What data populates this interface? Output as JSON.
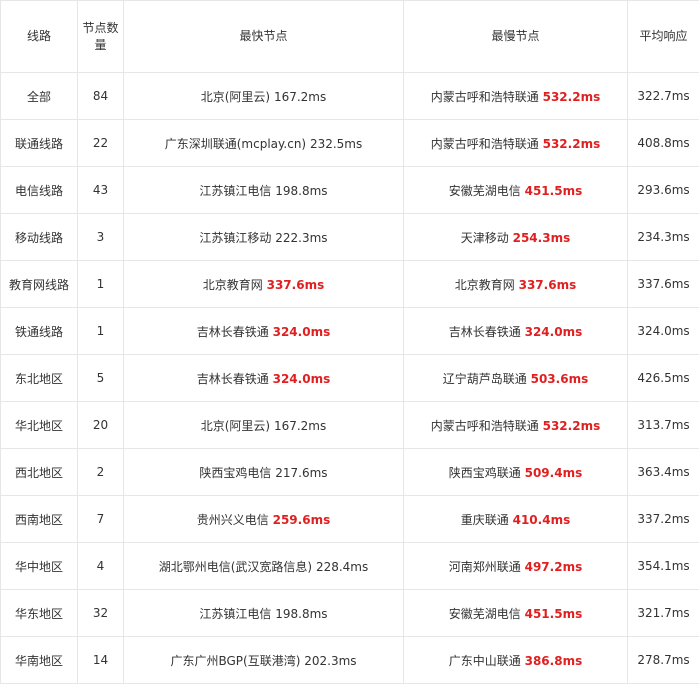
{
  "headers": {
    "line": "线路",
    "count": "节点数量",
    "fastest": "最快节点",
    "slowest": "最慢节点",
    "avg": "平均响应"
  },
  "highlight_color": "#e02020",
  "rows": [
    {
      "line": "全部",
      "count": "84",
      "fast_name": "北京(阿里云)",
      "fast_ms": "167.2ms",
      "fast_hl": false,
      "slow_name": "内蒙古呼和浩特联通",
      "slow_ms": "532.2ms",
      "slow_hl": true,
      "avg": "322.7ms"
    },
    {
      "line": "联通线路",
      "count": "22",
      "fast_name": "广东深圳联通(mcplay.cn)",
      "fast_ms": "232.5ms",
      "fast_hl": false,
      "slow_name": "内蒙古呼和浩特联通",
      "slow_ms": "532.2ms",
      "slow_hl": true,
      "avg": "408.8ms"
    },
    {
      "line": "电信线路",
      "count": "43",
      "fast_name": "江苏镇江电信",
      "fast_ms": "198.8ms",
      "fast_hl": false,
      "slow_name": "安徽芜湖电信",
      "slow_ms": "451.5ms",
      "slow_hl": true,
      "avg": "293.6ms"
    },
    {
      "line": "移动线路",
      "count": "3",
      "fast_name": "江苏镇江移动",
      "fast_ms": "222.3ms",
      "fast_hl": false,
      "slow_name": "天津移动",
      "slow_ms": "254.3ms",
      "slow_hl": true,
      "avg": "234.3ms"
    },
    {
      "line": "教育网线路",
      "count": "1",
      "fast_name": "北京教育网",
      "fast_ms": "337.6ms",
      "fast_hl": true,
      "slow_name": "北京教育网",
      "slow_ms": "337.6ms",
      "slow_hl": true,
      "avg": "337.6ms"
    },
    {
      "line": "铁通线路",
      "count": "1",
      "fast_name": "吉林长春铁通",
      "fast_ms": "324.0ms",
      "fast_hl": true,
      "slow_name": "吉林长春铁通",
      "slow_ms": "324.0ms",
      "slow_hl": true,
      "avg": "324.0ms"
    },
    {
      "line": "东北地区",
      "count": "5",
      "fast_name": "吉林长春铁通",
      "fast_ms": "324.0ms",
      "fast_hl": true,
      "slow_name": "辽宁葫芦岛联通",
      "slow_ms": "503.6ms",
      "slow_hl": true,
      "avg": "426.5ms"
    },
    {
      "line": "华北地区",
      "count": "20",
      "fast_name": "北京(阿里云)",
      "fast_ms": "167.2ms",
      "fast_hl": false,
      "slow_name": "内蒙古呼和浩特联通",
      "slow_ms": "532.2ms",
      "slow_hl": true,
      "avg": "313.7ms"
    },
    {
      "line": "西北地区",
      "count": "2",
      "fast_name": "陕西宝鸡电信",
      "fast_ms": "217.6ms",
      "fast_hl": false,
      "slow_name": "陕西宝鸡联通",
      "slow_ms": "509.4ms",
      "slow_hl": true,
      "avg": "363.4ms"
    },
    {
      "line": "西南地区",
      "count": "7",
      "fast_name": "贵州兴义电信",
      "fast_ms": "259.6ms",
      "fast_hl": true,
      "slow_name": "重庆联通",
      "slow_ms": "410.4ms",
      "slow_hl": true,
      "avg": "337.2ms"
    },
    {
      "line": "华中地区",
      "count": "4",
      "fast_name": "湖北鄂州电信(武汉宽路信息)",
      "fast_ms": "228.4ms",
      "fast_hl": false,
      "slow_name": "河南郑州联通",
      "slow_ms": "497.2ms",
      "slow_hl": true,
      "avg": "354.1ms"
    },
    {
      "line": "华东地区",
      "count": "32",
      "fast_name": "江苏镇江电信",
      "fast_ms": "198.8ms",
      "fast_hl": false,
      "slow_name": "安徽芜湖电信",
      "slow_ms": "451.5ms",
      "slow_hl": true,
      "avg": "321.7ms"
    },
    {
      "line": "华南地区",
      "count": "14",
      "fast_name": "广东广州BGP(互联港湾)",
      "fast_ms": "202.3ms",
      "fast_hl": false,
      "slow_name": "广东中山联通",
      "slow_ms": "386.8ms",
      "slow_hl": true,
      "avg": "278.7ms"
    }
  ]
}
